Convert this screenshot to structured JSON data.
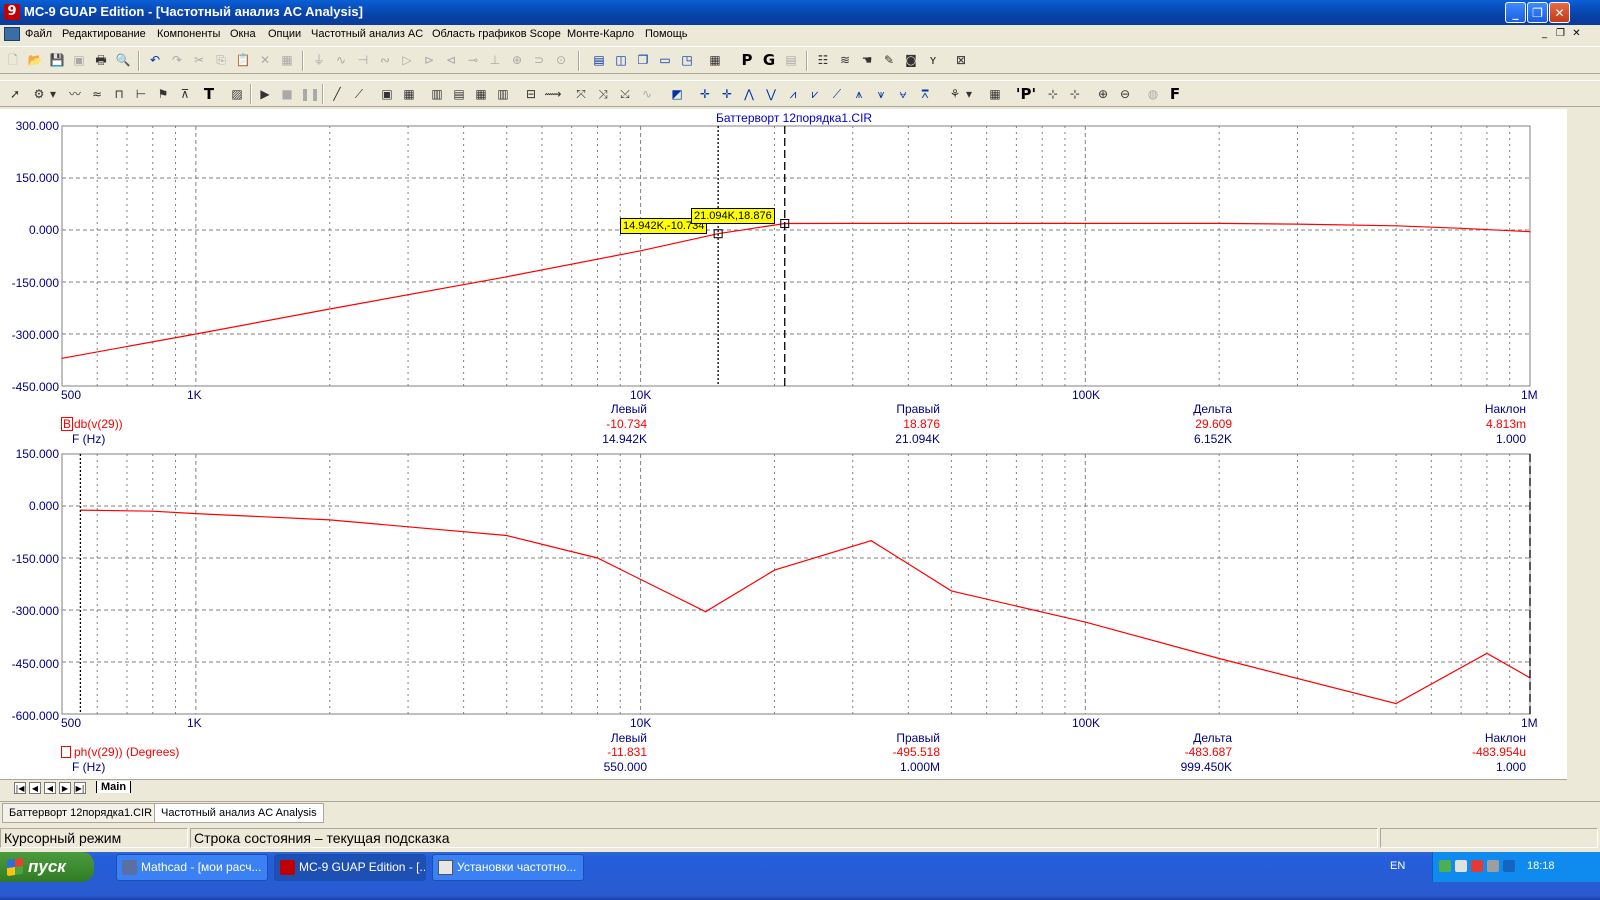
{
  "window": {
    "title": "MC-9 GUAP Edition - [Частотный анализ AC Analysis]",
    "icon": "mc9-app-icon",
    "controls": [
      "minimize",
      "restore",
      "close"
    ]
  },
  "menu": [
    "Файл",
    "Редактирование",
    "Компоненты",
    "Окна",
    "Опции",
    "Частотный анализ AC",
    "Область графиков Scope",
    "Монте-Карло",
    "Помощь"
  ],
  "toolbar_labels": {
    "p": "P",
    "g": "G",
    "f": "F",
    "t": "T",
    "p2": "'P'"
  },
  "plot": {
    "file_title": "Баттерворт 12порядка1.CIR",
    "accent": "#ff0000",
    "grid_color": "#808080",
    "axis_text_color": "#000080",
    "x_tick_labels": [
      "500",
      "1K",
      "10K",
      "100K",
      "1M"
    ],
    "top": {
      "y_tick_labels": [
        "300.000",
        "150.000",
        "0.000",
        "-150.000",
        "-300.000",
        "-450.000"
      ],
      "left_cursor_tag": "14.942K,-10.734",
      "right_cursor_tag": "21.094K,18.876",
      "readout": {
        "headers": [
          "Левый",
          "Правый",
          "Дельта",
          "Наклон"
        ],
        "expr_marker": "B",
        "y_expr": "db(v(29))",
        "x_expr": "F (Hz)",
        "y_values": [
          "-10.734",
          "18.876",
          "29.609",
          "4.813m"
        ],
        "x_values": [
          "14.942K",
          "21.094K",
          "6.152K",
          "1.000"
        ]
      }
    },
    "bottom": {
      "y_tick_labels": [
        "150.000",
        "0.000",
        "-150.000",
        "-300.000",
        "-450.000",
        "-600.000"
      ],
      "readout": {
        "headers": [
          "Левый",
          "Правый",
          "Дельта",
          "Наклон"
        ],
        "y_expr": "ph(v(29)) (Degrees)",
        "x_expr": "F (Hz)",
        "y_values": [
          "-11.831",
          "-495.518",
          "-483.687",
          "-483.954u"
        ],
        "x_values": [
          "550.000",
          "1.000M",
          "999.450K",
          "1.000"
        ]
      }
    }
  },
  "chart_data": [
    {
      "type": "line",
      "xlabel": "F (Hz)",
      "ylabel": "db(v(29))",
      "xscale": "log",
      "xlim": [
        500,
        1000000
      ],
      "ylim": [
        -450,
        300
      ],
      "grid": true,
      "series": [
        {
          "name": "db(v(29))",
          "x": [
            500,
            1000,
            2000,
            5000,
            10000,
            14942,
            21094,
            30000,
            50000,
            100000,
            200000,
            300000,
            500000,
            700000,
            1000000
          ],
          "y": [
            -370,
            -300,
            -228,
            -135,
            -60,
            -10.734,
            18.876,
            19,
            19,
            19,
            19,
            17,
            12,
            5,
            -5
          ]
        }
      ],
      "cursors": [
        {
          "name": "left",
          "x": 14942,
          "y": -10.734
        },
        {
          "name": "right",
          "x": 21094,
          "y": 18.876
        }
      ]
    },
    {
      "type": "line",
      "xlabel": "F (Hz)",
      "ylabel": "ph(v(29)) (Degrees)",
      "xscale": "log",
      "xlim": [
        500,
        1000000
      ],
      "ylim": [
        -600,
        150
      ],
      "grid": true,
      "series": [
        {
          "name": "ph(v(29)) (Degrees)",
          "x": [
            550,
            800,
            1000,
            2000,
            3000,
            5000,
            8000,
            14000,
            20000,
            33000,
            50000,
            100000,
            200000,
            500000,
            800000,
            1000000
          ],
          "y": [
            -11.831,
            -15,
            -22,
            -40,
            -60,
            -85,
            -150,
            -305,
            -185,
            -100,
            -245,
            -335,
            -440,
            -570,
            -425,
            -495.518
          ]
        }
      ],
      "cursors": [
        {
          "name": "left",
          "x": 550,
          "y": -11.831
        },
        {
          "name": "right",
          "x": 1000000,
          "y": -495.518
        }
      ]
    }
  ],
  "sheet_tab": "Main",
  "doc_tabs": [
    "Баттерворт 12порядка1.CIR",
    "Частотный анализ AC Analysis"
  ],
  "status": {
    "mode": "Курсорный режим",
    "hint": "Строка состояния – текущая подсказка"
  },
  "taskbar": {
    "start": "пуск",
    "buttons": [
      "Mathcad - [мои расч...",
      "MC-9 GUAP Edition - [...",
      "Установки частотно..."
    ],
    "lang": "EN",
    "clock": "18:18"
  }
}
